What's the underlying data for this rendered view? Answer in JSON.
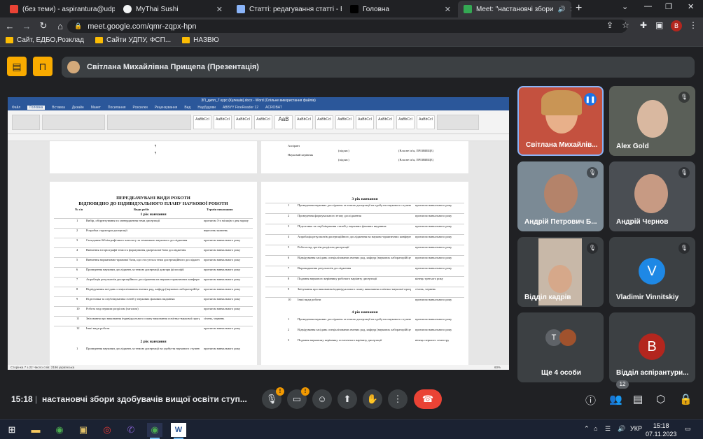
{
  "browser": {
    "tabs": [
      {
        "title": "(без теми) - aspirantura@udpu",
        "favicon_color": "#ea4335",
        "active": false
      },
      {
        "title": "MyThai Sushi",
        "favicon_color": "#f1f3f4",
        "active": false
      },
      {
        "title": "Статті: редагування статті - Вд",
        "favicon_color": "#8ab4f8",
        "active": false
      },
      {
        "title": "Головна",
        "favicon_color": "#202124",
        "active": false
      },
      {
        "title": "Meet: \"настановчі збори",
        "favicon_color": "#34a853",
        "active": true
      }
    ],
    "url": "meet.google.com/qmr-zqpx-hpn",
    "profile_initial": "В",
    "bookmarks": [
      "Сайт, ЕДБО,Розклад",
      "Сайти УДПУ, ФСП...",
      "НАЗВЮ"
    ]
  },
  "meet": {
    "presenter_label": "Світлана Михайлівна Прищепа (Презентація)",
    "participants": [
      {
        "name": "Світлана Михайлів...",
        "muted": false,
        "speaking": true
      },
      {
        "name": "Alex Gold",
        "muted": true
      },
      {
        "name": "Андрій Петрович Б...",
        "muted": true
      },
      {
        "name": "Андрій Чернов",
        "muted": true
      },
      {
        "name": "Відділ кадрів",
        "muted": true
      },
      {
        "name": "Vladimir Vinnitskiy",
        "muted": true,
        "initial": "V",
        "color": "#1e88e5"
      },
      {
        "name": "Ще 4 особи",
        "initials": [
          "Т",
          ""
        ]
      },
      {
        "name": "Відділ аспірантури...",
        "initial": "В",
        "color": "#b3261e"
      }
    ],
    "time": "15:18",
    "meeting_title": "настановчі збори здобувачів вищої освіти ступ...",
    "participant_count": "12",
    "warning_symbol": "!"
  },
  "doc": {
    "window_title": "ЗП_дипл_7 курс (Кулешів).docx - Word (Спільне використання файлів)",
    "menu": [
      "Файл",
      "Головна",
      "Вставка",
      "Дизайн",
      "Макет",
      "Посилання",
      "Розсилки",
      "Рецензування",
      "Вид",
      "Надбудови",
      "ABBYY FineReader 12",
      "ACROBAT"
    ],
    "styles": [
      "AaBbCcI",
      "AaBbCcI",
      "AaBbCcI",
      "AaBbCcI",
      "AaB",
      "AaBbCcI",
      "AaBbCcI",
      "AaBbCcI",
      "AaBbCcI",
      "AaBbCcI",
      "AaBbCcI",
      "AaBbCcI"
    ],
    "left_title_1": "ПЕРЕДБАЧУВАНІ ВИДИ РОБОТИ",
    "left_title_2": "ВІДПОВІДНО ДО ІНДИВІДУАЛЬНОГО ПЛАНУ НАУКОВОЇ РОБОТИ",
    "col_headers": [
      "№ з/п",
      "Види робіт",
      "Термін виконання"
    ],
    "section_1": "1 рік навчання",
    "section_2": "2 рік навчання",
    "section_3": "3 рік навчання",
    "section_4": "4 рік навчання",
    "left_rows": [
      {
        "n": "1",
        "work": "Вибір, обґрунтування та затвердження теми дисертації",
        "term": "протягом 3-х місяців з дня зарахування"
      },
      {
        "n": "2",
        "work": "Розробка структури дисертації",
        "term": "вересень-жовтень"
      },
      {
        "n": "3",
        "work": "Складання бібліографічного каталогу за тематикою наукового дослідження",
        "term": "протягом навчального року"
      },
      {
        "n": "4",
        "work": "Вивчення історіографії теми та формування джерельної бази дослідження",
        "term": "протягом навчального року"
      },
      {
        "n": "5",
        "work": "Вивчення нормативно-правової бази, що стосується теми дисертаційного дослідження",
        "term": "протягом навчального року"
      },
      {
        "n": "6",
        "work": "Проведення наукових досліджень за темою дисертації доктора філософії",
        "term": "протягом навчального року"
      },
      {
        "n": "7",
        "work": "Апробація результатів дисертаційного дослідження на науково-практичних конференціях і круглих столах, семінарах з опублікуванням тез доповідей та повідомлень",
        "term": "протягом навчального року"
      },
      {
        "n": "8",
        "work": "Відвідування засідань спеціалізованих вчених рад, кафедр (наукових лабораторій/центрів), розширених засідань та міждисциплінарних семінарів",
        "term": "протягом навчального року"
      },
      {
        "n": "9",
        "work": "Підготовка та опублікування статей у наукових фахових виданнях",
        "term": "протягом навчального року"
      },
      {
        "n": "10",
        "work": "Робота над першим розділом (загалом)",
        "term": "протягом навчального року"
      },
      {
        "n": "11",
        "work": "Звітування про виконання індивідуального плану виконання освітньо-наукової програми підготовки доктора філософії",
        "term": "січень, червень"
      },
      {
        "n": "12",
        "work": "Інші види роботи",
        "term": "протягом навчального року"
      },
      {
        "n": "1",
        "work": "Проведення наукових досліджень за темою дисертації на здобуття наукового ступеня доктора філософії",
        "term": "протягом навчального року"
      }
    ],
    "right_rows": [
      {
        "n": "1",
        "work": "Проведення наукових досліджень за темою дисертації на здобуття наукового ступеня доктора філософії",
        "term": "протягом навчального року"
      },
      {
        "n": "2",
        "work": "Проведення формувального етапу дослідження",
        "term": "протягом навчального року"
      },
      {
        "n": "3",
        "work": "Підготовка та опублікування статей у наукових фахових виданнях",
        "term": "протягом навчального року"
      },
      {
        "n": "4",
        "work": "Апробація результатів дисертаційного дослідження на науково-практичних конференціях і круглих столах",
        "term": "протягом навчального року"
      },
      {
        "n": "5",
        "work": "Робота над третім розділом дисертації",
        "term": "протягом навчального року"
      },
      {
        "n": "6",
        "work": "Відвідування засідань спеціалізованих вчених рад, кафедр (наукових лабораторій/центрів), розширених засідань та міждисциплінарних семінарів",
        "term": "протягом навчального року"
      },
      {
        "n": "7",
        "work": "Впровадження результатів дослідження",
        "term": "протягом навчального року"
      },
      {
        "n": "8",
        "work": "Подання наукового керівнику робочого варіанту дисертації",
        "term": "кінець третього року"
      },
      {
        "n": "9",
        "work": "Звітування про виконання індивідуального плану виконання освітньо-наукової програми підготовки доктора філософії",
        "term": "січень, червень"
      },
      {
        "n": "10",
        "work": "Інші види роботи",
        "term": "протягом навчального року"
      },
      {
        "n": "1",
        "work": "Проведення наукових досліджень за темою дисертації на здобуття наукового ступеня доктора філософії",
        "term": "протягом навчального року"
      },
      {
        "n": "2",
        "work": "Відвідування засідань спеціалізованих вчених рад, кафедр (наукових лабораторій/центрів), розширених засідань та міждисциплінарних семінарів",
        "term": "протягом навчального року"
      },
      {
        "n": "3",
        "work": "Подання науковому керівнику остаточного варіанту дисертації",
        "term": "кінець першого семестру"
      }
    ],
    "top_right_1": "Аспірант",
    "top_right_2": "Науковий керівник",
    "sign_1": "(підпис)",
    "sign_2": "(Власне ім'я, ПРІЗВИЩЕ)",
    "status_text": "Сторінка 7 з 22   Число слів: 2196   українська",
    "zoom": "60%"
  },
  "taskbar": {
    "lang": "УКР",
    "time": "15:18",
    "date": "07.11.2023"
  }
}
